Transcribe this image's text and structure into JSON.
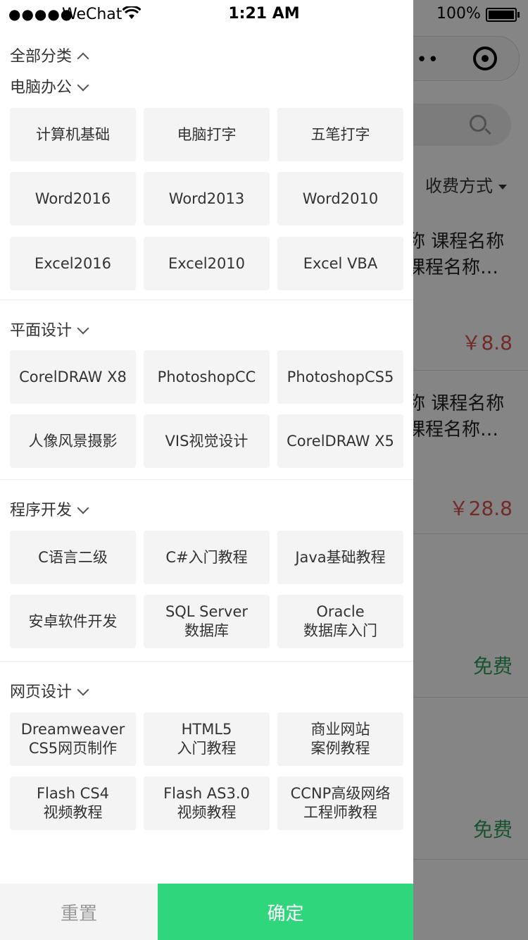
{
  "status_bar": {
    "carrier": "WeChat",
    "time": "1:21 AM",
    "battery": "100%"
  },
  "background": {
    "filter_label": "收费方式",
    "courses": [
      {
        "name_line1": "称  课程名称",
        "name_line2": "课程名称…",
        "price": "￥8.8"
      },
      {
        "name_line1": "称  课程名称",
        "name_line2": "课程名称…",
        "price": "￥28.8"
      },
      {
        "price": "免费"
      },
      {
        "price": "免费"
      }
    ],
    "colors": {
      "price_red": "#d9534f",
      "price_free": "#2e9e5b"
    }
  },
  "drawer": {
    "all_label": "全部分类",
    "sections": [
      {
        "title": "电脑办公",
        "items": [
          "计算机基础",
          "电脑打字",
          "五笔打字",
          "Word2016",
          "Word2013",
          "Word2010",
          "Excel2016",
          "Excel2010",
          "Excel VBA"
        ]
      },
      {
        "title": "平面设计",
        "items": [
          "CorelDRAW X8",
          "PhotoshopCC",
          "PhotoshopCS5",
          "人像风景摄影",
          "VIS视觉设计",
          "CorelDRAW X5"
        ]
      },
      {
        "title": "程序开发",
        "items": [
          "C语言二级",
          "C#入门教程",
          "Java基础教程",
          "安卓软件开发",
          "SQL Server\n数据库",
          "Oracle\n数据库入门"
        ]
      },
      {
        "title": "网页设计",
        "items": [
          "Dreamweaver\nCS5网页制作",
          "HTML5\n入门教程",
          "商业网站\n案例教程",
          "Flash CS4\n视频教程",
          "Flash AS3.0\n视频教程",
          "CCNP高级网络\n工程师教程"
        ]
      }
    ],
    "reset_label": "重置",
    "confirm_label": "确定",
    "colors": {
      "confirm": "#2fd67c",
      "chip_bg": "#f4f4f4"
    }
  }
}
